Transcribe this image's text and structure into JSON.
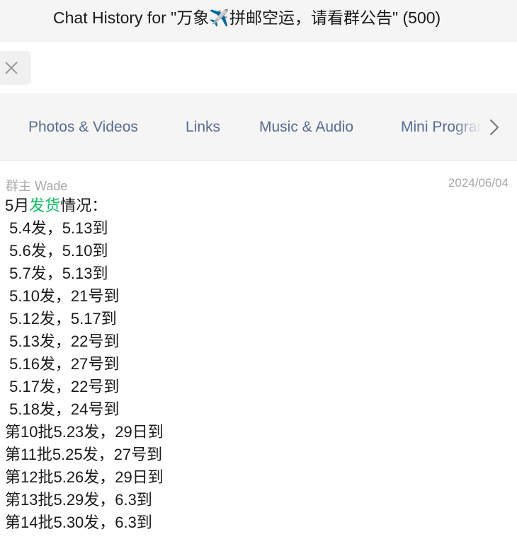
{
  "window": {
    "title": "Chat History for \"万象✈️拼邮空运，请看群公告\" (500)"
  },
  "search": {
    "value": "",
    "close_icon": "close-icon"
  },
  "tabs": [
    {
      "label": "Photos & Videos"
    },
    {
      "label": "Links"
    },
    {
      "label": "Music & Audio"
    },
    {
      "label": "Mini Programs"
    }
  ],
  "tabs_scroll_icon": "chevron-right-icon",
  "message": {
    "sender": "群主 Wade",
    "date": "2024/06/04",
    "header": {
      "prefix": "5月",
      "highlight": "发货",
      "suffix": "情况："
    },
    "highlight_color": "#07c160",
    "lines": [
      " 5.4发，5.13到",
      " 5.6发，5.10到",
      " 5.7发，5.13到",
      " 5.10发，21号到",
      " 5.12发，5.17到",
      " 5.13发，22号到",
      " 5.16发，27号到",
      " 5.17发，22号到",
      " 5.18发，24号到",
      "第10批5.23发，29日到",
      "第11批5.25发，27号到",
      "第12批5.26发，29日到",
      "第13批5.29发，6.3到",
      "第14批5.30发，6.3到"
    ]
  }
}
